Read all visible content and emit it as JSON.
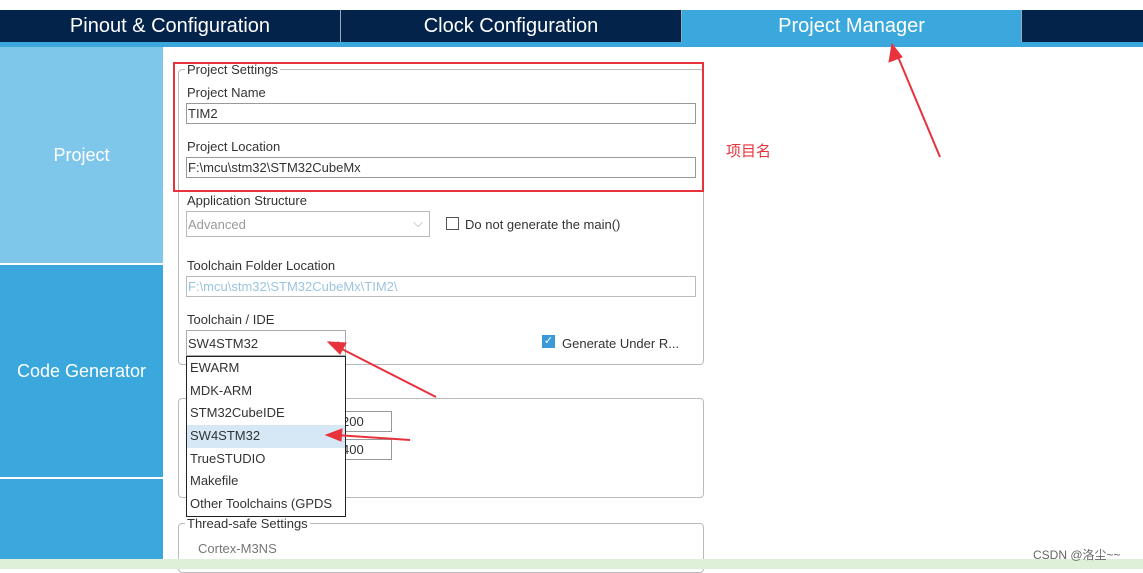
{
  "tabs": [
    {
      "label": "Pinout & Configuration"
    },
    {
      "label": "Clock Configuration"
    },
    {
      "label": "Project Manager",
      "active": true
    },
    {
      "label": ""
    }
  ],
  "sidebar": {
    "items": [
      {
        "label": "Project",
        "active": true
      },
      {
        "label": "Code Generator"
      },
      {
        "label": ""
      }
    ]
  },
  "project_settings": {
    "legend": "Project Settings",
    "name_label": "Project Name",
    "name_value": "TIM2",
    "location_label": "Project Location",
    "location_value": "F:\\mcu\\stm32\\STM32CubeMx",
    "app_structure_label": "Application Structure",
    "app_structure_value": "Advanced",
    "no_main_label": "Do not generate the main()",
    "no_main_checked": false,
    "toolchain_folder_label": "Toolchain Folder Location",
    "toolchain_folder_value": "F:\\mcu\\stm32\\STM32CubeMx\\TIM2\\",
    "toolchain_label": "Toolchain / IDE",
    "toolchain_value": "SW4STM32",
    "generate_under_root_label": "Generate Under R...",
    "generate_under_root_checked": true
  },
  "toolchain_options": [
    "EWARM",
    "MDK-ARM",
    "STM32CubeIDE",
    "SW4STM32",
    "TrueSTUDIO",
    "Makefile",
    "Other Toolchains (GPDS"
  ],
  "selected_option": "SW4STM32",
  "linker": {
    "heap_value": "200",
    "stack_value": "400"
  },
  "thread_safe": {
    "legend": "Thread-safe Settings",
    "core": "Cortex-M3NS"
  },
  "annotation": {
    "label": "项目名",
    "color": "#e8323c"
  },
  "watermark": "CSDN @洛尘~~",
  "colors": {
    "navy": "#03234b",
    "active_tab": "#3aa8dc",
    "sidebar_active": "#7ec6ea"
  }
}
